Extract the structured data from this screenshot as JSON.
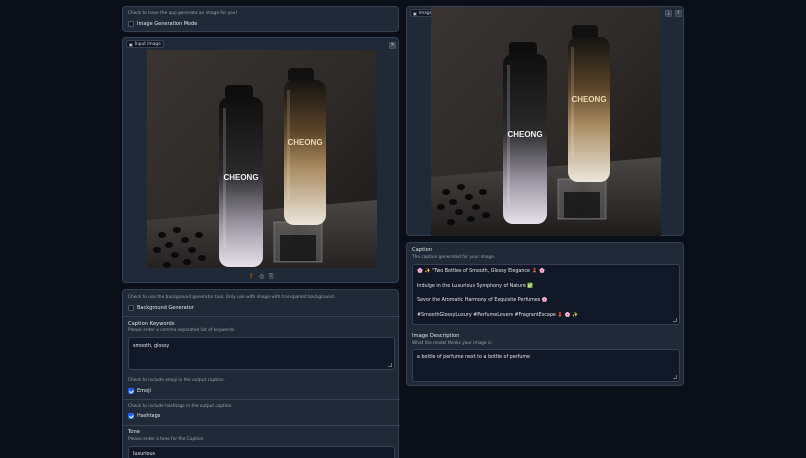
{
  "left_top": {
    "hint": "Check to have the app generate an image for you!",
    "checkbox_label": "Image Generation Mode"
  },
  "input_image": {
    "label": "Input Image"
  },
  "bg_section": {
    "hint": "Check to use the background generator tool. Only use with image with transparent background.",
    "checkbox_label": "Background Generator"
  },
  "keywords": {
    "label": "Caption Keywords",
    "hint": "Please enter a comma separated list of keywords.",
    "value": "smooth, glossy"
  },
  "emoji": {
    "hint": "Check to include emoji in the output caption.",
    "label": "Emoji"
  },
  "hashtags": {
    "hint": "Check to include hashtags in the output caption.",
    "label": "Hashtags"
  },
  "tone": {
    "label": "Tone",
    "hint": "Please enter a tone for the Caption.",
    "value": "luxurious"
  },
  "output_image": {
    "label": "Image"
  },
  "caption": {
    "label": "Caption",
    "hint": "The caption generated for your image.",
    "lines": [
      "🌸 ✨ \"Two Bottles of Smooth, Glossy Elegance 💄 🌸",
      "Indulge in the Luxurious Symphony of Nature ✅",
      "Savor the Aromatic Harmony of Exquisite Perfumes 🌸",
      "#SmoothGlossyLuxury #PerfumeLovers #FragrantEscape 💄 🌸 ✨"
    ]
  },
  "description": {
    "label": "Image Description",
    "hint": "What the model thinks your image is.",
    "value": "a bottle of perfume next to a bottle of perfume"
  },
  "product_brand": "CHEONG",
  "colors": {
    "page_bg": "#0b0f19",
    "panel_bg": "#1f2937",
    "field_bg": "#111827",
    "checkbox_accent": "#2563eb"
  }
}
